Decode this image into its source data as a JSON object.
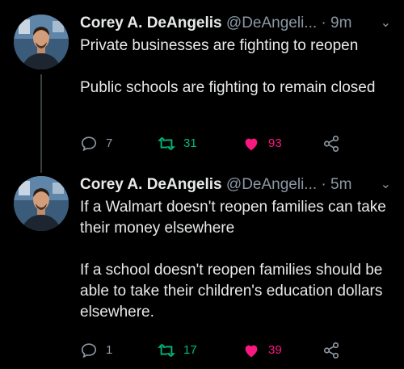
{
  "tweets": [
    {
      "name": "Corey A. DeAngelis",
      "handle": "@DeAngeli...",
      "separator": "·",
      "time": "9m",
      "paragraphs": [
        "Private businesses are fighting to reopen",
        "Public schools are fighting to remain closed"
      ],
      "reply_count": "7",
      "retweet_count": "31",
      "like_count": "93"
    },
    {
      "name": "Corey A. DeAngelis",
      "handle": "@DeAngeli...",
      "separator": "·",
      "time": "5m",
      "paragraphs": [
        "If a Walmart doesn't reopen families can take their money elsewhere",
        "If a school doesn't reopen families should be able to take their children's education dollars elsewhere."
      ],
      "reply_count": "1",
      "retweet_count": "17",
      "like_count": "39"
    }
  ],
  "icons": {
    "reply": "reply-icon",
    "retweet": "retweet-icon",
    "like": "heart-icon",
    "share": "share-icon",
    "more": "chevron-down-icon"
  },
  "colors": {
    "background": "#000000",
    "text": "#e7e9ea",
    "muted": "#8b98a5",
    "retweet": "#00ba7c",
    "like": "#f91880"
  }
}
